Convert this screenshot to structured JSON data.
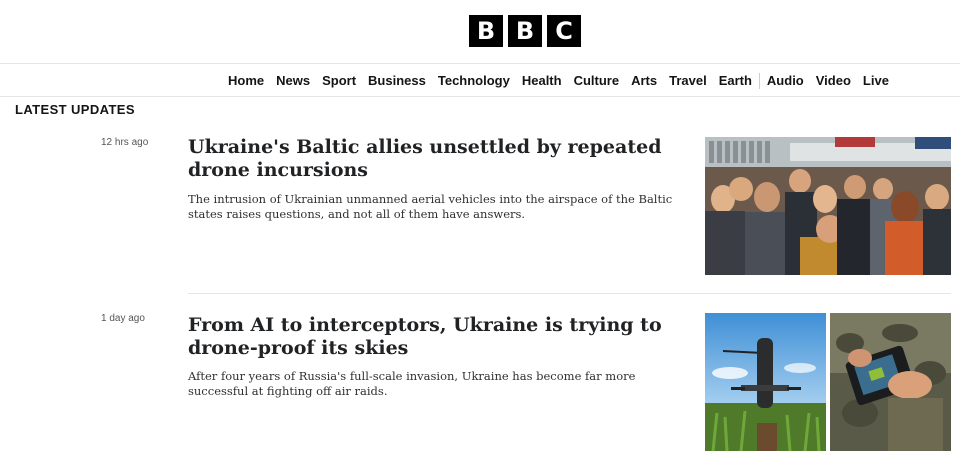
{
  "logo": {
    "letters": [
      "B",
      "B",
      "C"
    ]
  },
  "nav": {
    "items": [
      "Home",
      "News",
      "Sport",
      "Business",
      "Technology",
      "Health",
      "Culture",
      "Arts",
      "Travel",
      "Earth",
      "Audio",
      "Video",
      "Live"
    ]
  },
  "section": {
    "title": "LATEST UPDATES"
  },
  "articles": [
    {
      "time": "12 hrs ago",
      "headline": "Ukraine's Baltic allies unsettled by repeated drone incursions",
      "summary": "The intrusion of Ukrainian unmanned aerial vehicles into the airspace of the Baltic states raises questions, and not all of them have answers."
    },
    {
      "time": "1 day ago",
      "headline": "From AI to interceptors, Ukraine is trying to drone-proof its skies",
      "summary": "After four years of Russia's full-scale invasion, Ukraine has become far more successful at fighting off air raids."
    }
  ]
}
